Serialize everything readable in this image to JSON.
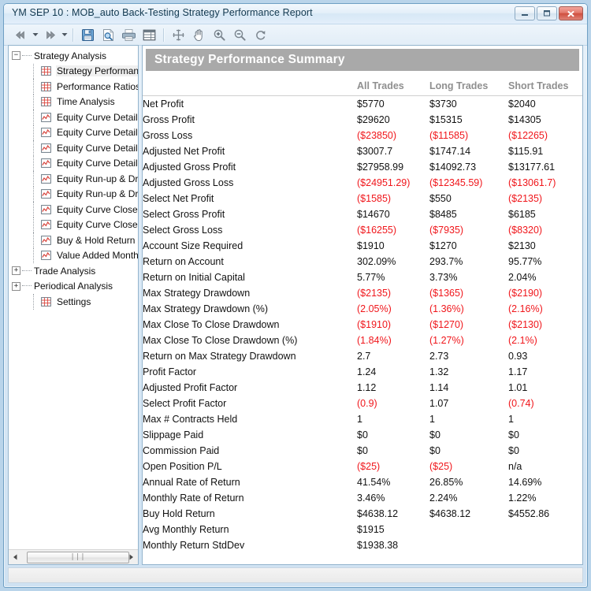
{
  "window": {
    "title": "YM  SEP 10 : MOB_auto Back-Testing Strategy Performance Report",
    "minimize_label": "Minimize",
    "maximize_label": "Maximize",
    "close_label": "Close"
  },
  "toolbar": {
    "items": [
      {
        "name": "back-button",
        "icon": "back-arrow-icon",
        "label": "Back"
      },
      {
        "name": "back-dropdown",
        "icon": "chevron-down-icon",
        "label": "Back history"
      },
      {
        "name": "forward-button",
        "icon": "forward-arrow-icon",
        "label": "Forward"
      },
      {
        "name": "forward-dropdown",
        "icon": "chevron-down-icon",
        "label": "Forward history"
      },
      {
        "name": "save-button",
        "icon": "floppy-disk-icon",
        "label": "Save"
      },
      {
        "name": "print-preview-button",
        "icon": "page-search-icon",
        "label": "Print Preview"
      },
      {
        "name": "print-button",
        "icon": "printer-icon",
        "label": "Print"
      },
      {
        "name": "grid-view-button",
        "icon": "table-grid-icon",
        "label": "Grid View"
      },
      {
        "name": "crosshair-button",
        "icon": "crosshair-icon",
        "label": "Crosshair"
      },
      {
        "name": "pan-button",
        "icon": "hand-icon",
        "label": "Pan"
      },
      {
        "name": "zoom-in-button",
        "icon": "magnifier-plus-icon",
        "label": "Zoom In"
      },
      {
        "name": "zoom-out-button",
        "icon": "magnifier-minus-icon",
        "label": "Zoom Out"
      },
      {
        "name": "reset-zoom-button",
        "icon": "rotate-refresh-icon",
        "label": "Reset"
      }
    ]
  },
  "tree": {
    "root": {
      "label": "Strategy Analysis",
      "expanded": true,
      "icon": "minus-box-icon"
    },
    "children": [
      {
        "label": "Strategy Performance",
        "icon": "table-icon",
        "selected": true
      },
      {
        "label": "Performance Ratios",
        "icon": "table-icon",
        "selected": false
      },
      {
        "label": "Time Analysis",
        "icon": "table-icon",
        "selected": false
      },
      {
        "label": "Equity Curve Detailed",
        "icon": "chart-icon",
        "selected": false
      },
      {
        "label": "Equity Curve Detailed",
        "icon": "chart-icon",
        "selected": false
      },
      {
        "label": "Equity Curve Detailed",
        "icon": "chart-icon",
        "selected": false
      },
      {
        "label": "Equity Curve Detailed",
        "icon": "chart-icon",
        "selected": false
      },
      {
        "label": "Equity Run-up & Drawdown",
        "icon": "chart-icon",
        "selected": false
      },
      {
        "label": "Equity Run-up & Drawdown",
        "icon": "chart-icon",
        "selected": false
      },
      {
        "label": "Equity Curve Close To Close",
        "icon": "chart-icon",
        "selected": false
      },
      {
        "label": "Equity Curve Close To Close",
        "icon": "chart-icon",
        "selected": false
      },
      {
        "label": "Buy & Hold Return",
        "icon": "chart-icon",
        "selected": false
      },
      {
        "label": "Value Added Monthly",
        "icon": "chart-icon",
        "selected": false
      }
    ],
    "siblings": [
      {
        "label": "Trade Analysis",
        "expanded": false,
        "icon": "plus-box-icon"
      },
      {
        "label": "Periodical Analysis",
        "expanded": false,
        "icon": "plus-box-icon"
      },
      {
        "label": "Settings",
        "expanded": null,
        "icon": "table-icon"
      }
    ],
    "scrollbar": {
      "left_label": "Scroll left",
      "right_label": "Scroll right",
      "thumb_label": "Horizontal scroll thumb"
    }
  },
  "report": {
    "title": "Strategy Performance Summary",
    "columns": [
      "",
      "All Trades",
      "Long Trades",
      "Short Trades"
    ],
    "rows": [
      {
        "label": "Net Profit",
        "all": "$5770",
        "long": "$3730",
        "short": "$2040",
        "neg": [
          false,
          false,
          false
        ]
      },
      {
        "label": "Gross Profit",
        "all": "$29620",
        "long": "$15315",
        "short": "$14305",
        "neg": [
          false,
          false,
          false
        ]
      },
      {
        "label": "Gross Loss",
        "all": "($23850)",
        "long": "($11585)",
        "short": "($12265)",
        "neg": [
          true,
          true,
          true
        ]
      },
      {
        "label": "Adjusted Net Profit",
        "all": "$3007.7",
        "long": "$1747.14",
        "short": "$115.91",
        "neg": [
          false,
          false,
          false
        ]
      },
      {
        "label": "Adjusted Gross Profit",
        "all": "$27958.99",
        "long": "$14092.73",
        "short": "$13177.61",
        "neg": [
          false,
          false,
          false
        ]
      },
      {
        "label": "Adjusted Gross Loss",
        "all": "($24951.29)",
        "long": "($12345.59)",
        "short": "($13061.7)",
        "neg": [
          true,
          true,
          true
        ]
      },
      {
        "label": "Select Net Profit",
        "all": "($1585)",
        "long": "$550",
        "short": "($2135)",
        "neg": [
          true,
          false,
          true
        ]
      },
      {
        "label": "Select Gross Profit",
        "all": "$14670",
        "long": "$8485",
        "short": "$6185",
        "neg": [
          false,
          false,
          false
        ]
      },
      {
        "label": "Select Gross Loss",
        "all": "($16255)",
        "long": "($7935)",
        "short": "($8320)",
        "neg": [
          true,
          true,
          true
        ]
      },
      {
        "label": "Account Size Required",
        "all": "$1910",
        "long": "$1270",
        "short": "$2130",
        "neg": [
          false,
          false,
          false
        ]
      },
      {
        "label": "Return on Account",
        "all": "302.09%",
        "long": "293.7%",
        "short": "95.77%",
        "neg": [
          false,
          false,
          false
        ]
      },
      {
        "label": "Return on Initial Capital",
        "all": "5.77%",
        "long": "3.73%",
        "short": "2.04%",
        "neg": [
          false,
          false,
          false
        ]
      },
      {
        "label": "Max Strategy Drawdown",
        "all": "($2135)",
        "long": "($1365)",
        "short": "($2190)",
        "neg": [
          true,
          true,
          true
        ]
      },
      {
        "label": "Max Strategy Drawdown (%)",
        "all": "(2.05%)",
        "long": "(1.36%)",
        "short": "(2.16%)",
        "neg": [
          true,
          true,
          true
        ]
      },
      {
        "label": "Max Close To Close Drawdown",
        "all": "($1910)",
        "long": "($1270)",
        "short": "($2130)",
        "neg": [
          true,
          true,
          true
        ]
      },
      {
        "label": "Max Close To Close Drawdown (%)",
        "all": "(1.84%)",
        "long": "(1.27%)",
        "short": "(2.1%)",
        "neg": [
          true,
          true,
          true
        ]
      },
      {
        "label": "Return on Max Strategy Drawdown",
        "all": "2.7",
        "long": "2.73",
        "short": "0.93",
        "neg": [
          false,
          false,
          false
        ]
      },
      {
        "label": "Profit Factor",
        "all": "1.24",
        "long": "1.32",
        "short": "1.17",
        "neg": [
          false,
          false,
          false
        ]
      },
      {
        "label": "Adjusted Profit Factor",
        "all": "1.12",
        "long": "1.14",
        "short": "1.01",
        "neg": [
          false,
          false,
          false
        ]
      },
      {
        "label": "Select Profit Factor",
        "all": "(0.9)",
        "long": "1.07",
        "short": "(0.74)",
        "neg": [
          true,
          false,
          true
        ]
      },
      {
        "label": "Max # Contracts Held",
        "all": "1",
        "long": "1",
        "short": "1",
        "neg": [
          false,
          false,
          false
        ]
      },
      {
        "label": "Slippage Paid",
        "all": "$0",
        "long": "$0",
        "short": "$0",
        "neg": [
          false,
          false,
          false
        ]
      },
      {
        "label": "Commission Paid",
        "all": "$0",
        "long": "$0",
        "short": "$0",
        "neg": [
          false,
          false,
          false
        ]
      },
      {
        "label": "Open Position P/L",
        "all": "($25)",
        "long": "($25)",
        "short": "n/a",
        "neg": [
          true,
          true,
          false
        ]
      },
      {
        "label": "Annual Rate of Return",
        "all": "41.54%",
        "long": "26.85%",
        "short": "14.69%",
        "neg": [
          false,
          false,
          false
        ]
      },
      {
        "label": "Monthly Rate of Return",
        "all": "3.46%",
        "long": "2.24%",
        "short": "1.22%",
        "neg": [
          false,
          false,
          false
        ]
      },
      {
        "label": "Buy  Hold Return",
        "all": "$4638.12",
        "long": "$4638.12",
        "short": "$4552.86",
        "neg": [
          false,
          false,
          false
        ]
      },
      {
        "label": "Avg Monthly Return",
        "all": "$1915",
        "long": "",
        "short": "",
        "neg": [
          false,
          false,
          false
        ]
      },
      {
        "label": "Monthly Return StdDev",
        "all": "$1938.38",
        "long": "",
        "short": "",
        "neg": [
          false,
          false,
          false
        ]
      }
    ]
  },
  "colors": {
    "negative": "#f0161b",
    "header_bar": "#a9a9a9",
    "column_header_text": "#8f8f8f",
    "window_chrome": "#cfe2f2"
  }
}
